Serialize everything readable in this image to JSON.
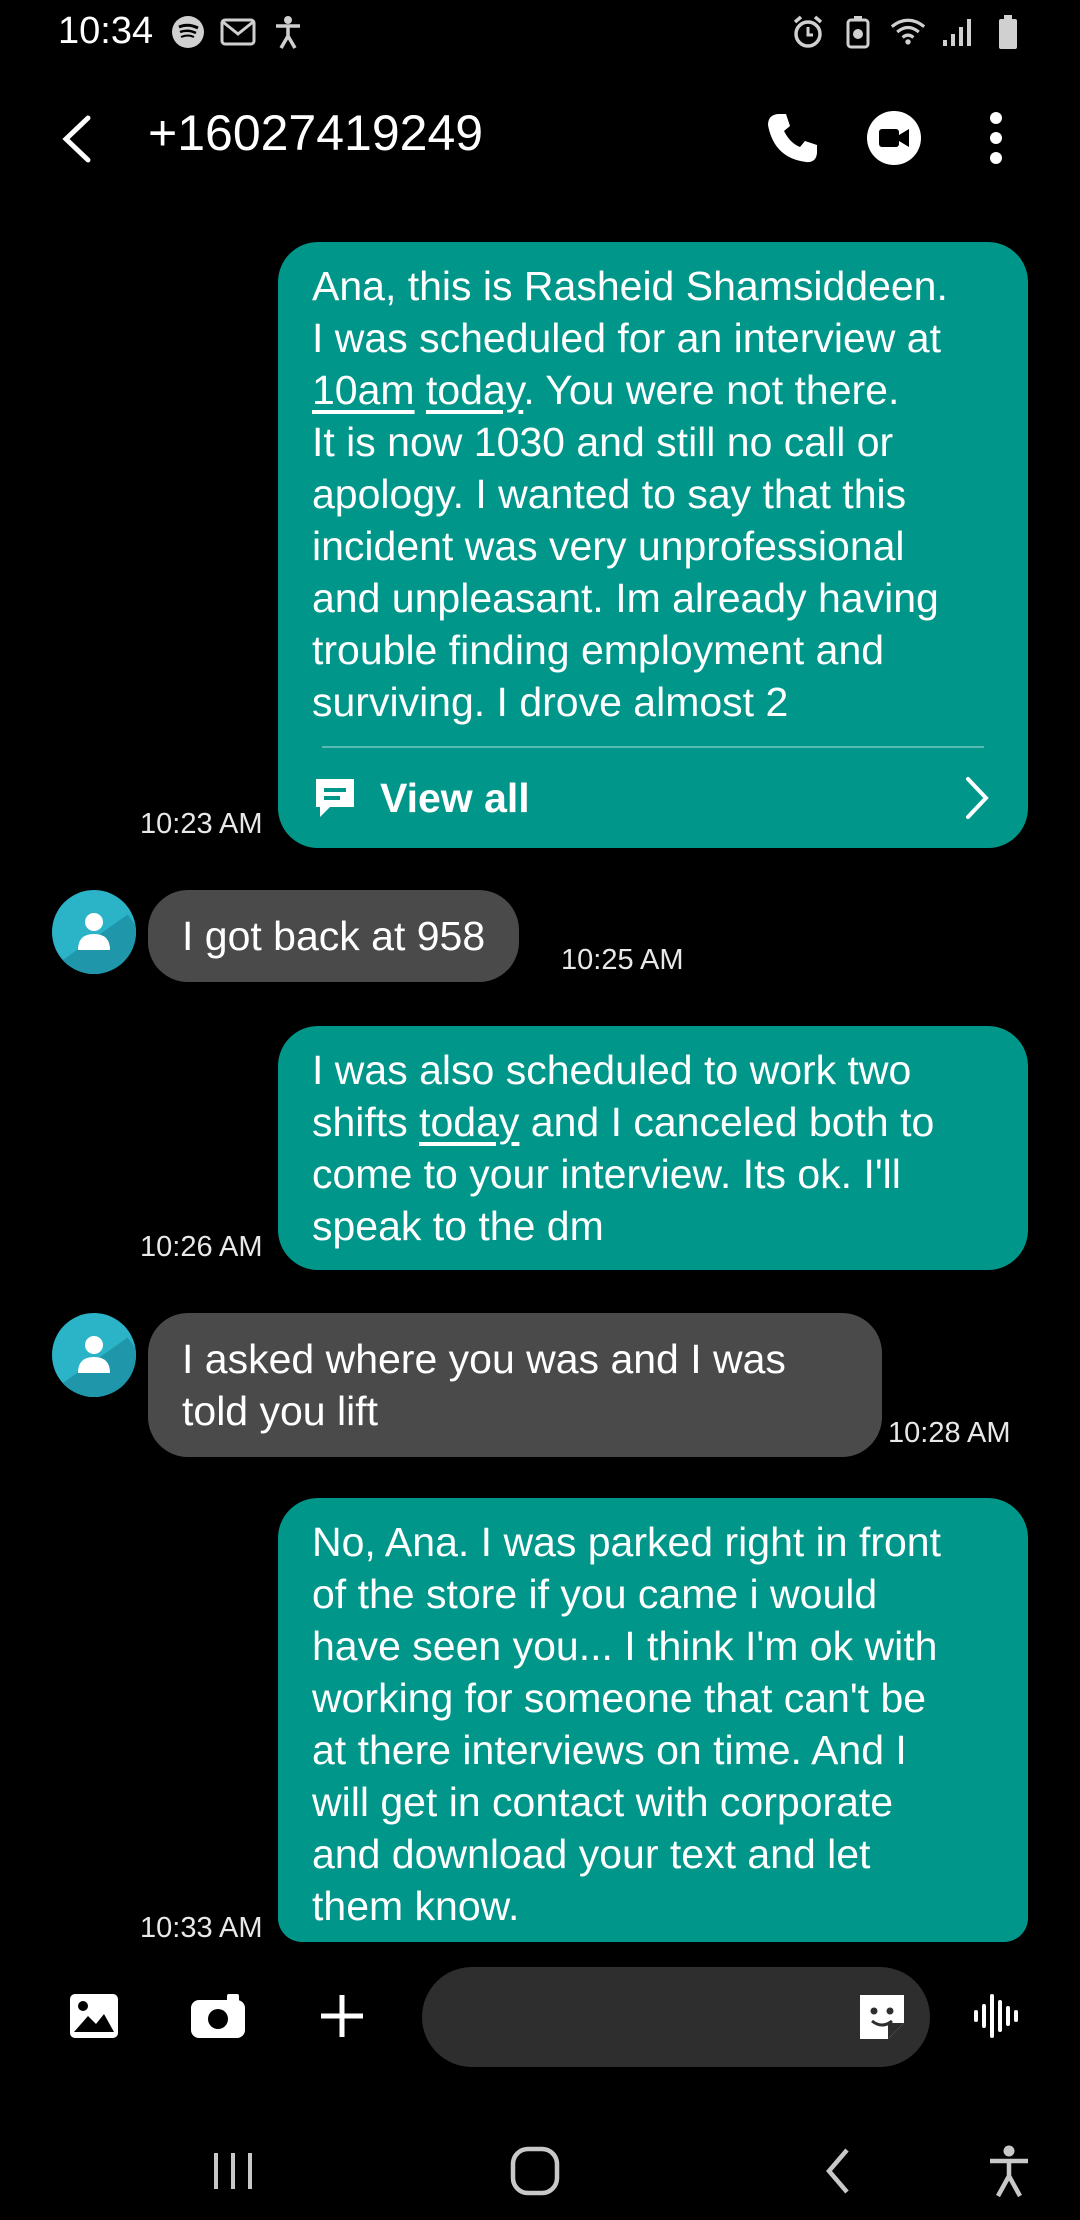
{
  "status_bar": {
    "time": "10:34",
    "left_icons": [
      "spotify-icon",
      "mail-icon",
      "accessibility-icon"
    ],
    "right_icons": [
      "alarm-icon",
      "battery-saver-icon",
      "wifi-icon",
      "signal-icon",
      "battery-icon"
    ]
  },
  "header": {
    "contact": "+16027419249",
    "actions": [
      "phone-icon",
      "video-call-icon",
      "more-options-icon"
    ]
  },
  "messages": [
    {
      "direction": "outgoing",
      "lines": [
        "Ana, this is Rasheid Shamsiddeen.",
        "I was scheduled for an interview at",
        "10am",
        "today",
        ". You were not there.",
        "It is now 1030 and still no call or",
        "apology. I  wanted to say that this",
        "incident was very unprofessional",
        "and unpleasant. Im already having",
        "trouble finding employment and",
        "surviving.  I drove almost 2"
      ],
      "view_all": "View all",
      "time": "10:23 AM"
    },
    {
      "direction": "incoming",
      "lines": [
        "I got back at 958"
      ],
      "time": "10:25 AM"
    },
    {
      "direction": "outgoing",
      "lines": [
        "I was also scheduled to work two",
        "shifts ",
        "today",
        " and I canceled both to",
        "come to your interview.  Its ok. I'll",
        "speak to the dm"
      ],
      "time": "10:26 AM"
    },
    {
      "direction": "incoming",
      "lines": [
        "I asked where you was and I was",
        "told you lift"
      ],
      "time": "10:28 AM"
    },
    {
      "direction": "outgoing",
      "lines": [
        "No, Ana. I was parked right in front",
        "of the store if you came i would",
        "have seen you... I think I'm ok with",
        "working for someone that can't be",
        "at there interviews on time. And I",
        "will get in contact with corporate",
        "and download your text and let",
        "them know."
      ],
      "time": "10:33 AM"
    }
  ],
  "composer": {
    "placeholder": "",
    "buttons": [
      "gallery-icon",
      "camera-icon",
      "add-icon",
      "sticker-icon",
      "voice-icon"
    ]
  },
  "colors": {
    "outgoing_bubble": "#00968a",
    "incoming_bubble": "#4a4a4a",
    "avatar": "#2bb3c8",
    "background": "#000000"
  }
}
